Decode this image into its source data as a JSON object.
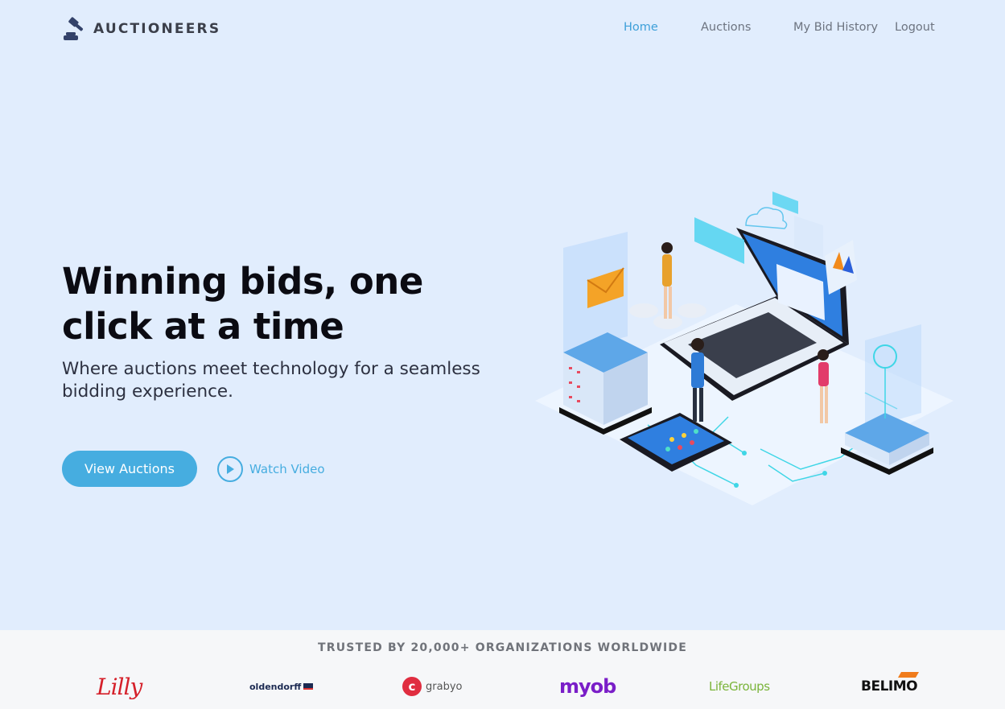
{
  "header": {
    "logo_text": "AUCTIONEERS",
    "nav": [
      {
        "label": "Home",
        "active": true
      },
      {
        "label": "Auctions",
        "active": false
      },
      {
        "label": "My Bid History",
        "active": false
      },
      {
        "label": "Logout",
        "active": false
      }
    ]
  },
  "hero": {
    "title": "Winning bids, one click at a time",
    "subtitle": "Where auctions meet technology for a seamless bidding experience.",
    "primary_button": "View Auctions",
    "video_button": "Watch Video"
  },
  "trust": {
    "title": "TRUSTED BY 20,000+ ORGANIZATIONS WORLDWIDE",
    "brands": [
      "Lilly",
      "oldendorff",
      "grabyo",
      "myob",
      "LifeGroups",
      "BELIMO"
    ]
  },
  "colors": {
    "accent": "#46ade0",
    "background": "#e1edfd",
    "text_dark": "#0b0b12"
  }
}
